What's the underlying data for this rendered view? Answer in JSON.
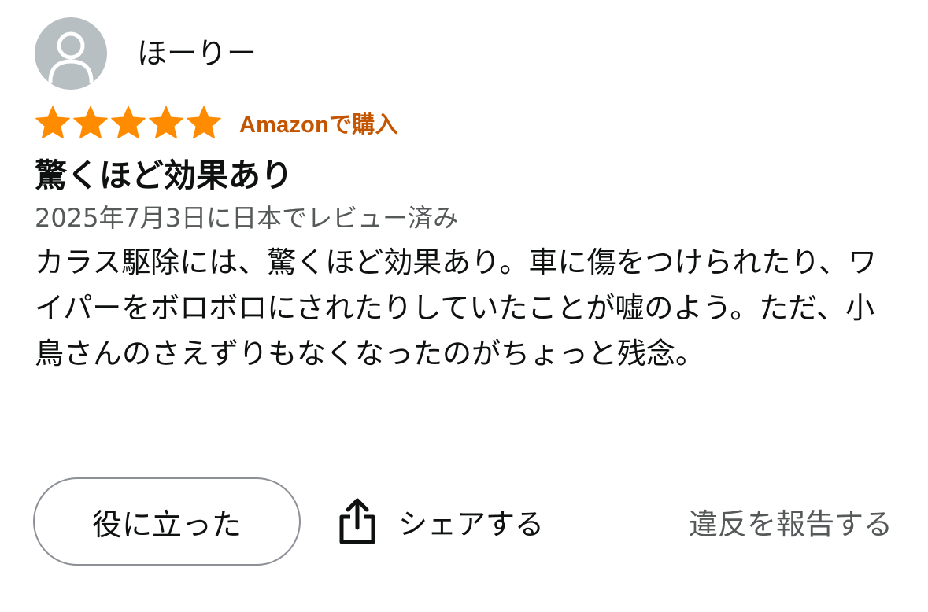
{
  "author": {
    "name": "ほーりー",
    "avatar_icon": "person-icon"
  },
  "rating": {
    "stars": 5,
    "max_stars": 5,
    "star_color": "#ff8c00",
    "badge": "Amazonで購入",
    "badge_color": "#c45500"
  },
  "review": {
    "title": "驚くほど効果あり",
    "date": "2025年7月3日に日本でレビュー済み",
    "body": "カラス駆除には、驚くほど効果あり。車に傷をつけられたり、ワイパーをボロボロにされたりしていたことが嘘のよう。ただ、小鳥さんのさえずりもなくなったのがちょっと残念。"
  },
  "actions": {
    "helpful_label": "役に立った",
    "share_label": "シェアする",
    "share_icon": "share-icon",
    "report_label": "違反を報告する"
  }
}
